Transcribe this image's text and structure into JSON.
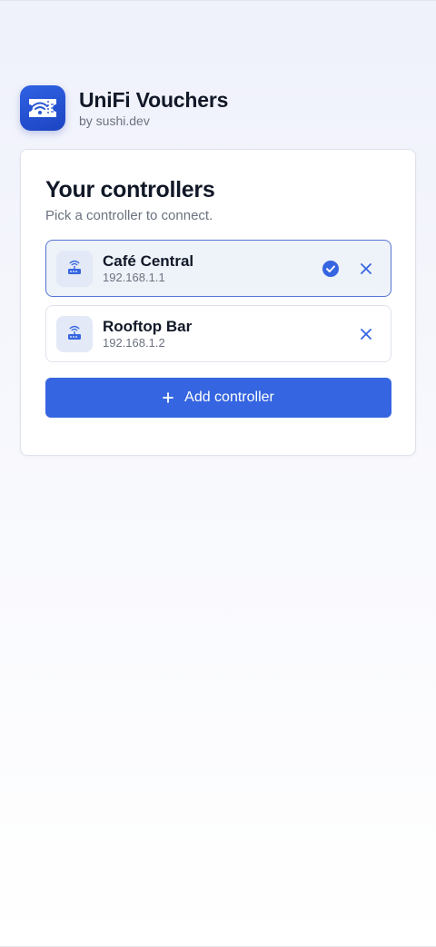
{
  "app": {
    "title": "UniFi Vouchers",
    "subtitle": "by sushi.dev",
    "icon": "voucher-ticket-wifi-icon"
  },
  "card": {
    "title": "Your controllers",
    "subtitle": "Pick a controller to connect."
  },
  "controllers": [
    {
      "name": "Café Central",
      "ip": "192.168.1.1",
      "selected": true,
      "icon": "router-icon"
    },
    {
      "name": "Rooftop Bar",
      "ip": "192.168.1.2",
      "selected": false,
      "icon": "router-icon"
    }
  ],
  "add_button": {
    "label": "Add controller",
    "icon": "plus-icon"
  },
  "colors": {
    "accent": "#3565e0",
    "selected_border": "#5675d6",
    "selected_bg": "#eef2f9",
    "text_primary": "#111827",
    "text_secondary": "#6b7280"
  }
}
